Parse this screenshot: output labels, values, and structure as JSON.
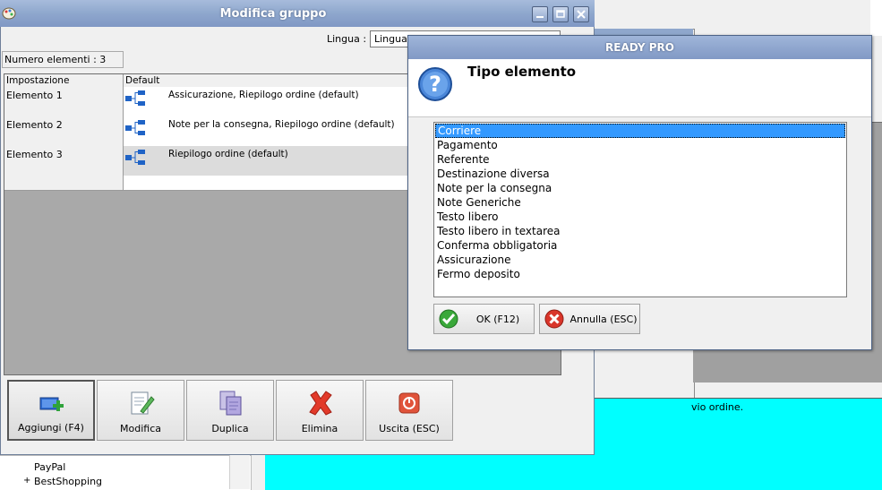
{
  "background": {
    "cyan_text": "vio ordine.",
    "tree_items": [
      "PayPal",
      "BestShopping"
    ],
    "tree_expand": "+"
  },
  "main_window": {
    "title": "Modifica gruppo",
    "lingua_label": "Lingua :",
    "lingua_value": "Lingua d",
    "numero_elementi": "Numero elementi : 3",
    "columns": [
      "Impostazione",
      "Default"
    ],
    "rows": [
      {
        "name": "Elemento 1",
        "value": "Assicurazione, Riepilogo ordine (default)"
      },
      {
        "name": "Elemento 2",
        "value": "Note per la consegna, Riepilogo ordine (default)"
      },
      {
        "name": "Elemento 3",
        "value": "Riepilogo ordine (default)"
      }
    ],
    "toolbar": {
      "add": "Aggiungi (F4)",
      "edit": "Modifica",
      "duplicate": "Duplica",
      "delete": "Elimina",
      "exit": "Uscita (ESC)"
    }
  },
  "dialog": {
    "title": "READY PRO",
    "heading": "Tipo elemento",
    "options": [
      "Corriere",
      "Pagamento",
      "Referente",
      "Destinazione diversa",
      "Note per la consegna",
      "Note Generiche",
      "Testo libero",
      "Testo libero in textarea",
      "Conferma obbligatoria",
      "Assicurazione",
      "Fermo deposito"
    ],
    "selected_index": 0,
    "ok_label": "OK (F12)",
    "cancel_label": "Annulla (ESC)"
  },
  "colors": {
    "title_bar": "#8ea7cd",
    "selection": "#3399ff",
    "cyan_panel": "#00ffff"
  }
}
